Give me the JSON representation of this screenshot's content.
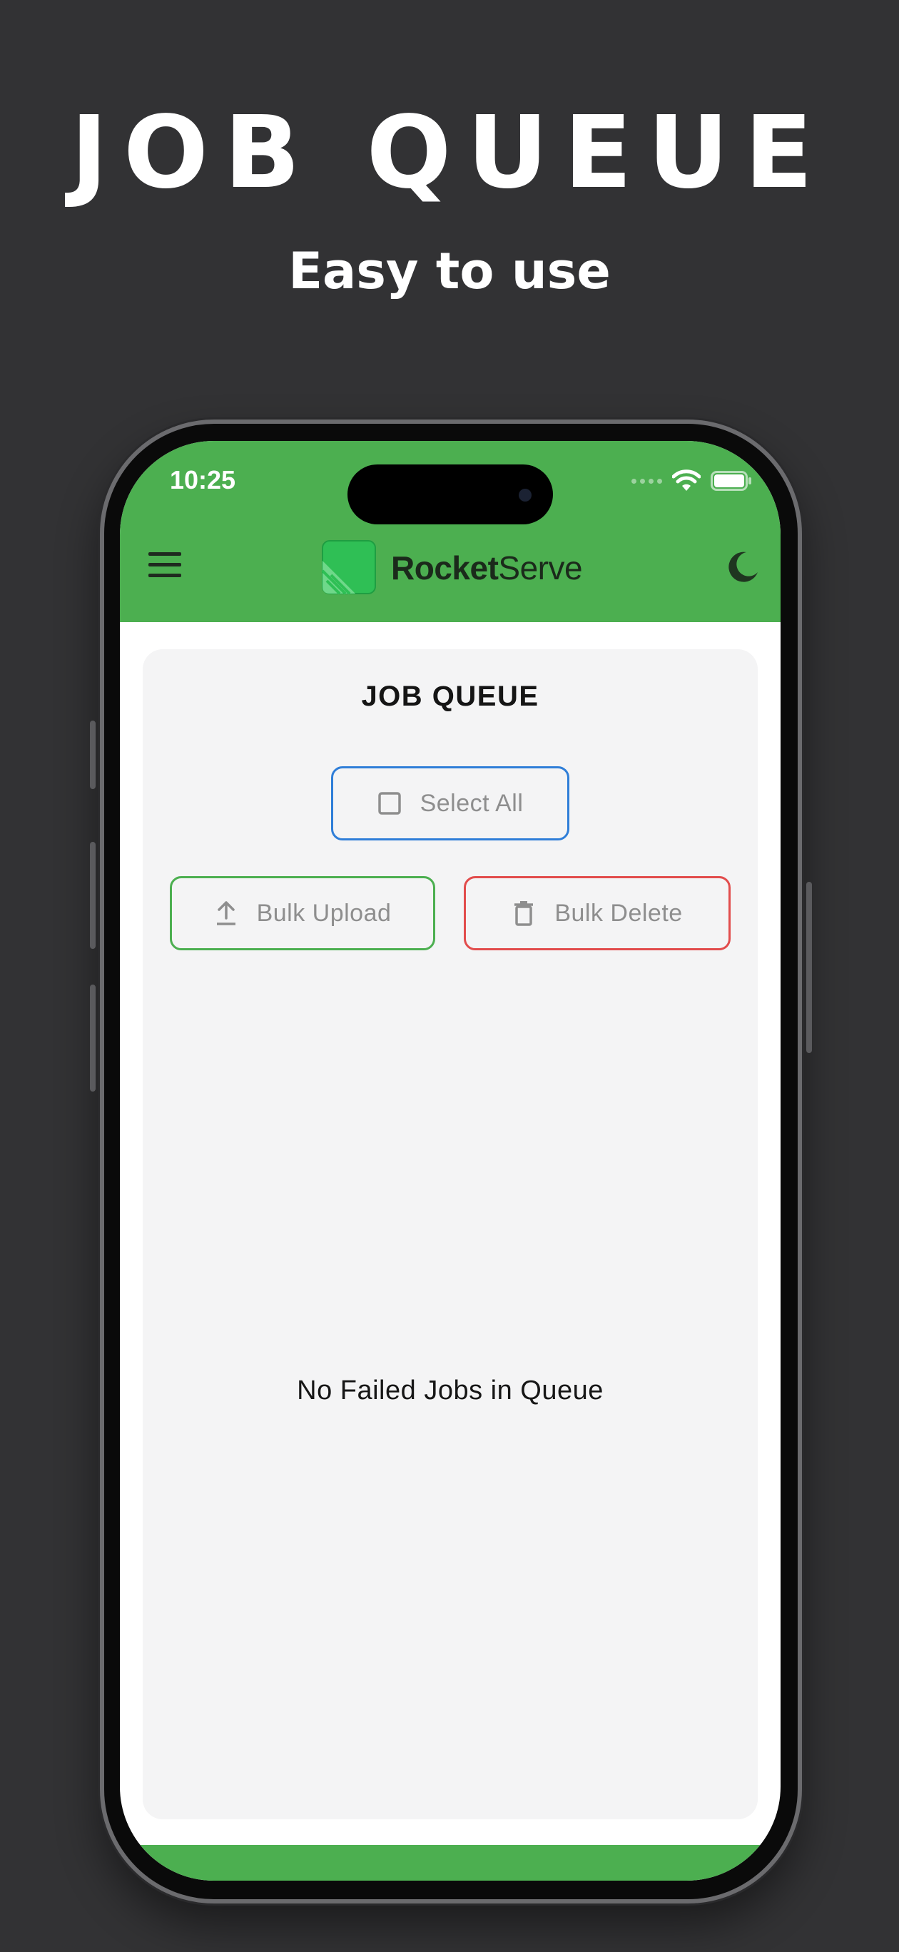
{
  "promo": {
    "title": "JOB QUEUE",
    "subtitle": "Easy to use"
  },
  "status_bar": {
    "time": "10:25",
    "icons": [
      "signal-dots-icon",
      "wifi-icon",
      "battery-icon"
    ]
  },
  "app_bar": {
    "brand_bold": "Rocket",
    "brand_regular": "Serve",
    "menu_icon": "hamburger-menu-icon",
    "theme_icon": "moon-icon"
  },
  "card": {
    "title": "JOB QUEUE",
    "select_all_label": "Select All",
    "bulk_upload_label": "Bulk Upload",
    "bulk_delete_label": "Bulk Delete",
    "empty_message": "No Failed Jobs in Queue"
  },
  "colors": {
    "background": "#323234",
    "app_green": "#4caf50",
    "select_blue": "#2f7ed8",
    "delete_red": "#e24c4c",
    "card_bg": "#f4f4f5"
  }
}
